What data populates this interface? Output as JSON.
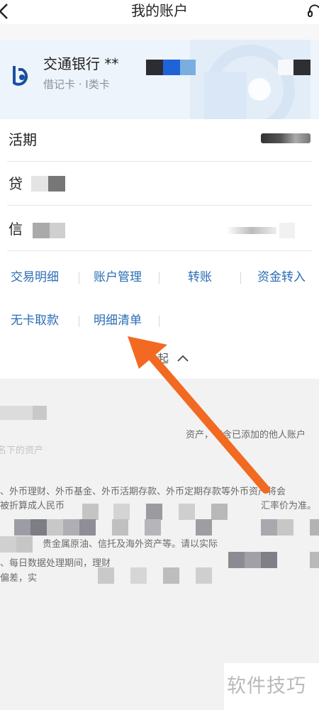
{
  "header": {
    "title": "我的账户"
  },
  "card": {
    "bank_name": "交通银行 **",
    "card_type": "借记卡 · I类卡"
  },
  "balances": [
    {
      "label": "活期"
    },
    {
      "label": "贷"
    },
    {
      "label": "信"
    }
  ],
  "actions": {
    "transactions": "交易明细",
    "account_management": "账户管理",
    "transfer": "转账",
    "fund_transfer_in": "资金转入",
    "cardless_withdrawal": "无卡取款",
    "statement_list": "明细清单",
    "collapse": "起"
  },
  "notes": {
    "line1": "资产，不含已添加的他人账户",
    "line2": "名下的资产",
    "line3": "、外币理财、外币基金、外币活期存款、外币定期存款等外币资产将会",
    "line4": "被折算成人民币",
    "line5": "汇率价为准。",
    "line6": "贵金属原油、信托及海外资产等。请以实际",
    "line7": "、每日数据处理期间，理财",
    "line8": "偏差，实"
  },
  "footer": {
    "watermark": "软件技巧"
  },
  "colors": {
    "accent": "#2a6db5",
    "arrow": "#f26a21",
    "card_bg": "#eef4fb"
  },
  "icons": [
    "back-icon",
    "headset-icon",
    "bank-logo-icon",
    "chevron-up-icon"
  ]
}
